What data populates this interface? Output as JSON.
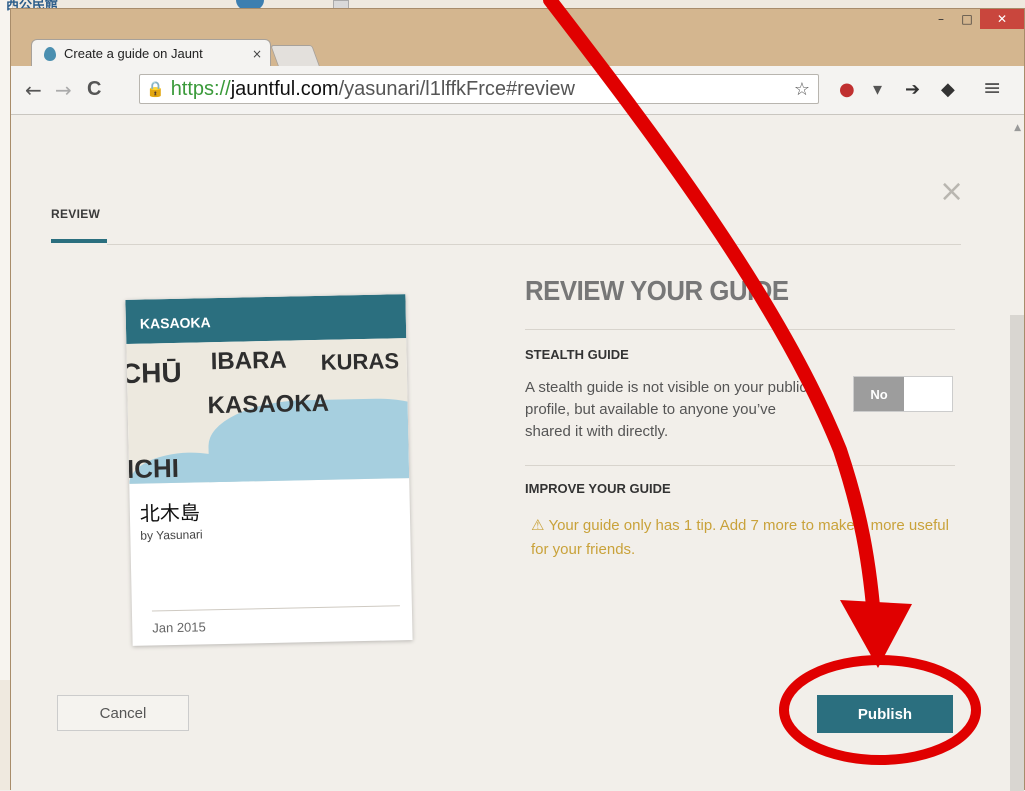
{
  "background": {
    "title_fragment": "西公民館"
  },
  "window_controls": {
    "minimize": "–",
    "maximize": "□",
    "close": "✕"
  },
  "tab": {
    "title": "Create a guide on Jaunt",
    "close_icon": "×"
  },
  "toolbar": {
    "back_icon": "←",
    "forward_icon": "→",
    "reload_icon": "C",
    "url": {
      "scheme": "https://",
      "host": "jauntful.com",
      "path": "/yasunari/l1lffkFrce#review"
    },
    "star_icon": "☆",
    "menu_icon": "≡"
  },
  "modal": {
    "close_icon": "×",
    "tab_label": "REVIEW",
    "card": {
      "header": "KASAOKA",
      "map_labels": [
        "CHŪ",
        "IBARA",
        "KURAS",
        "KASAOKA",
        "ICHI"
      ],
      "title": "北木島",
      "author": "by Yasunari",
      "date": "Jan 2015"
    },
    "heading": "REVIEW YOUR GUIDE",
    "stealth": {
      "title": "STEALTH GUIDE",
      "description": "A stealth guide is not visible on your public profile, but available to anyone you’ve shared it with directly.",
      "toggle_label": "No"
    },
    "improve": {
      "title": "IMPROVE YOUR GUIDE",
      "warning_icon": "⚠",
      "warning": "Your guide only has 1 tip. Add 7 more to make it more useful for your friends."
    },
    "cancel_label": "Cancel",
    "publish_label": "Publish"
  },
  "colors": {
    "accent": "#2b6f7f",
    "annotation": "#e00000",
    "warning": "#c9a23a"
  }
}
